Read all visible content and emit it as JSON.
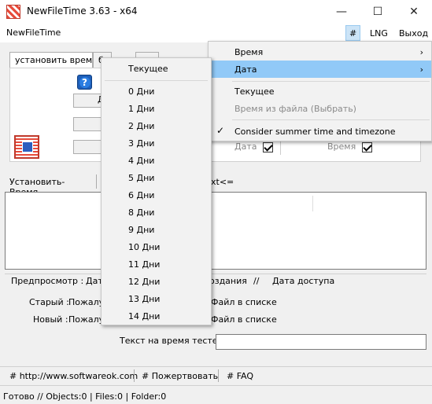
{
  "window": {
    "title": "NewFileTime 3.63 - x64",
    "minimize": "—",
    "maximize": "☐",
    "close": "✕"
  },
  "menubar": {
    "app_label": "NewFileTime",
    "hash": "#",
    "lng": "LNG",
    "exit": "Выход"
  },
  "tabs": [
    {
      "label": "установить время"
    },
    {
      "label": "б"
    },
    {
      "label": "."
    }
  ],
  "panel": {
    "field1_text": "Д",
    "date_label": "Дата",
    "time_label": "Время",
    "date_checked": true,
    "time_checked": true
  },
  "action_row": {
    "set_time_button": "Установить-Время",
    "text_fragment": "xt<="
  },
  "preview": {
    "heading": "Предпросмотр  :",
    "heading_frag": "Дат",
    "created_label": "оздания",
    "sep": "//",
    "access_label": "Дата доступа",
    "old_label": "Старый :",
    "old_value": "Пожалуй",
    "new_label": "Новый :",
    "new_value": "Пожалуй",
    "file_in_list": "Файл в списке",
    "file_in_list2": "Файл в списке"
  },
  "tester": {
    "label": "Текст на время тестер",
    "value": ""
  },
  "links": {
    "website": "# http://www.softwareok.com",
    "donate": "# Пожертвовать",
    "faq": "# FAQ"
  },
  "statusbar": {
    "text": "Готово // Objects:0 | Files:0  | Folder:0"
  },
  "main_menu": {
    "items": [
      {
        "label": "Время",
        "submenu": true,
        "selected": false
      },
      {
        "label": "Дата",
        "submenu": true,
        "selected": true
      },
      {
        "label": "Текущее",
        "disabled": false
      },
      {
        "label": "Время из файла (Выбрать)",
        "disabled": true
      },
      {
        "label": "Consider summer time and timezone",
        "checked": true
      }
    ]
  },
  "date_submenu": {
    "items": [
      "Текущее",
      "0 Дни",
      "1 Дни",
      "2 Дни",
      "3 Дни",
      "4 Дни",
      "5 Дни",
      "6 Дни",
      "8 Дни",
      "9 Дни",
      "10 Дни",
      "11 Дни",
      "12 Дни",
      "13 Дни",
      "14 Дни"
    ]
  },
  "colors": {
    "menu_highlight": "#91c9f7",
    "toolbar_highlight": "#cce4f7"
  }
}
